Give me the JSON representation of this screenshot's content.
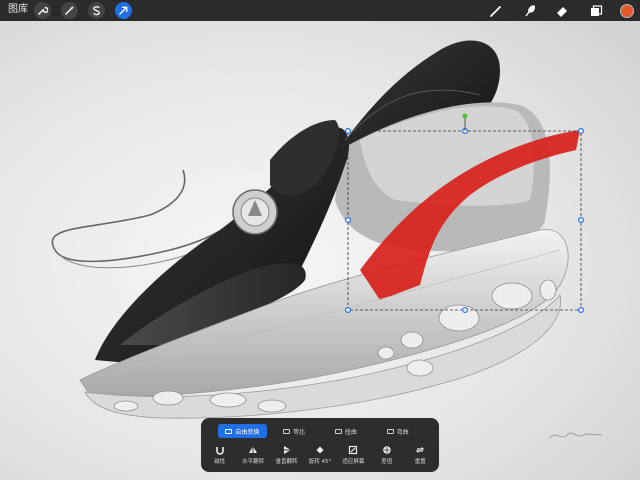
{
  "topbar": {
    "gallery_label": "图库",
    "tools_left": [
      {
        "name": "actions",
        "icon": "wrench-icon"
      },
      {
        "name": "adjustments",
        "icon": "magic-wand-icon"
      },
      {
        "name": "selection",
        "icon": "selection-s-icon"
      },
      {
        "name": "transform",
        "icon": "arrow-cursor-icon",
        "active": true
      }
    ],
    "tools_right": [
      {
        "name": "brush",
        "icon": "brush-icon"
      },
      {
        "name": "smudge",
        "icon": "smudge-icon"
      },
      {
        "name": "eraser",
        "icon": "eraser-icon"
      },
      {
        "name": "layers",
        "icon": "layers-icon"
      }
    ],
    "current_color": "#e2572b"
  },
  "transform_panel": {
    "modes": [
      {
        "label": "自由变换",
        "active": true
      },
      {
        "label": "等比",
        "active": false
      },
      {
        "label": "扭曲",
        "active": false
      },
      {
        "label": "弯曲",
        "active": false
      }
    ],
    "actions": [
      {
        "label": "磁性",
        "icon": "magnet-icon"
      },
      {
        "label": "水平翻转",
        "icon": "flip-horizontal-icon"
      },
      {
        "label": "垂直翻转",
        "icon": "flip-vertical-icon"
      },
      {
        "label": "旋转 45°",
        "icon": "rotate-icon"
      },
      {
        "label": "适应屏幕",
        "icon": "fit-screen-icon"
      },
      {
        "label": "差值",
        "icon": "interpolation-icon"
      },
      {
        "label": "重置",
        "icon": "reset-icon"
      }
    ]
  },
  "colors": {
    "accent": "#1f6fe5",
    "toolbar": "#2b2b2b",
    "red_stripe": "#d8211c"
  }
}
